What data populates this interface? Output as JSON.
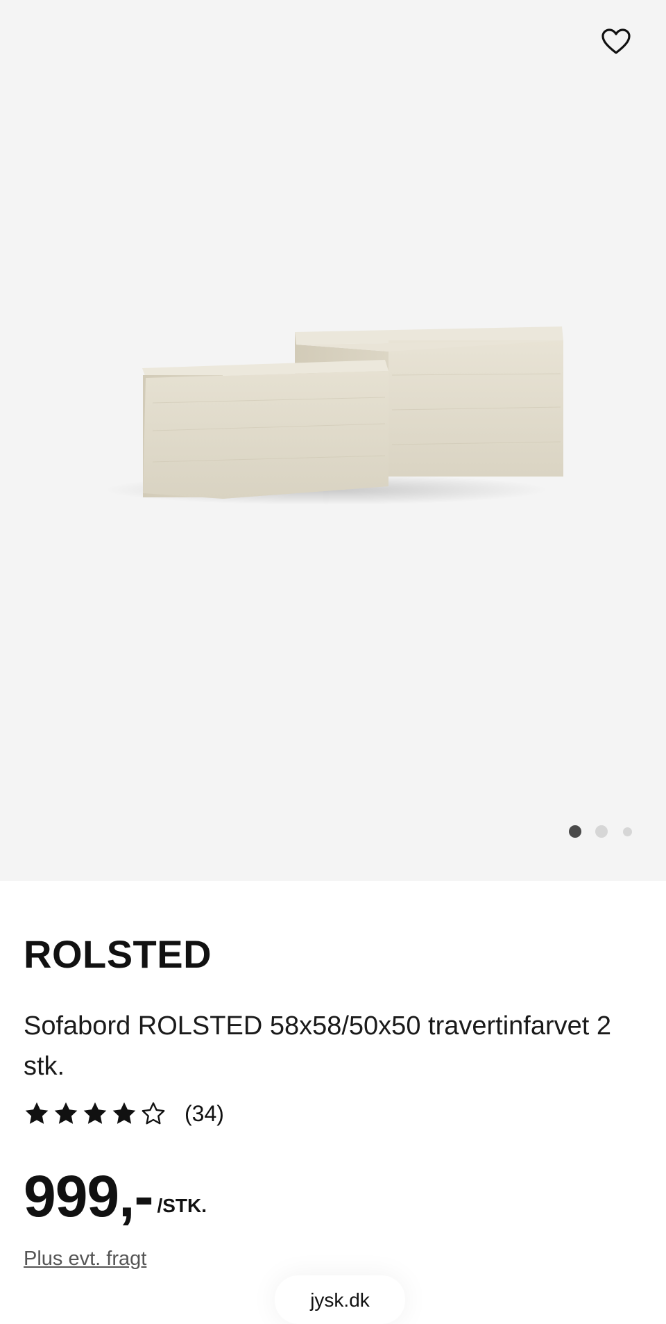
{
  "product": {
    "brand": "ROLSTED",
    "description": "Sofabord ROLSTED 58x58/50x50 travertinfarvet 2 stk.",
    "rating": {
      "value": 4,
      "max": 5,
      "count_label": "(34)"
    },
    "price": "999,-",
    "price_unit": "/STK.",
    "shipping_note": "Plus evt. fragt"
  },
  "gallery": {
    "total_images": 3,
    "active_index": 0,
    "favorite_icon": "heart-outline-icon",
    "background": "#f4f4f4"
  },
  "browser": {
    "url": "jysk.dk"
  }
}
